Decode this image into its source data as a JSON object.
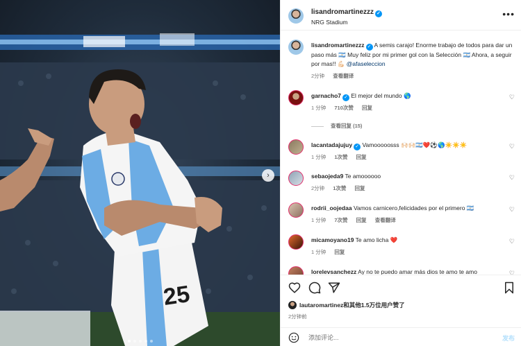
{
  "colors": {
    "verified": "#0095f6",
    "link": "#00376b",
    "muted": "#737373",
    "heart": "#e0245e",
    "post_disabled": "#b2dffc"
  },
  "post": {
    "jersey_number": "25",
    "carousel": {
      "dots": 5,
      "active_index": 0
    }
  },
  "header": {
    "username": "lisandromartinezzz",
    "location": "NRG Stadium",
    "more_icon": "more-horizontal-icon"
  },
  "caption": {
    "username": "lisandromartinezzz",
    "text_before": "A semis carajo! Enorme trabajo de todos para dar un paso más 🇦🇷 Muy feliz por mi primer gol con la Selección 🇦🇷 Ahora, a seguir por mas!! 💪🏻",
    "mention": "@afaseleccion",
    "time": "2分钟",
    "translate": "查看翻译"
  },
  "comments": [
    {
      "username": "garnacho7",
      "verified": true,
      "text": "El mejor del mundo 🌎",
      "time": "1 分钟",
      "likes": "710次赞",
      "reply": "回复",
      "translate": ""
    },
    {
      "username": "lacantadajujuy",
      "verified": true,
      "text": "Vamooooosss 🙌🏻🙌🏻🇦🇷❤️⚽🌎☀️☀️☀️",
      "time": "1 分钟",
      "likes": "1次赞",
      "reply": "回复",
      "translate": ""
    },
    {
      "username": "sebaojeda9",
      "verified": false,
      "text": "Te amoooooo",
      "time": "2分钟",
      "likes": "1次赞",
      "reply": "回复",
      "translate": ""
    },
    {
      "username": "rodrii_oojedaa",
      "verified": false,
      "text": "Vamos carnicero,felicidades por el primero 🇦🇷",
      "time": "1 分钟",
      "likes": "7次赞",
      "reply": "回复",
      "translate": "查看翻译"
    },
    {
      "username": "micamoyano19",
      "verified": false,
      "text": "Te amo licha ❤️",
      "time": "1 分钟",
      "likes": "",
      "reply": "回复",
      "translate": ""
    },
    {
      "username": "lorelevsanchezz",
      "verified": false,
      "text": "Ay no te puedo amar más dios te amo te amo",
      "time": "",
      "likes": "",
      "reply": "",
      "translate": ""
    }
  ],
  "view_replies": "查看回复 (15)",
  "actions": {
    "like": "heart-icon",
    "comment": "comment-icon",
    "share": "share-icon",
    "save": "bookmark-icon"
  },
  "likes_line": {
    "user": "lautaromartinez",
    "rest": "和其他1.5万位用户赞了"
  },
  "post_time": "2分钟前",
  "add_comment": {
    "placeholder": "添加评论...",
    "post_label": "发布"
  }
}
